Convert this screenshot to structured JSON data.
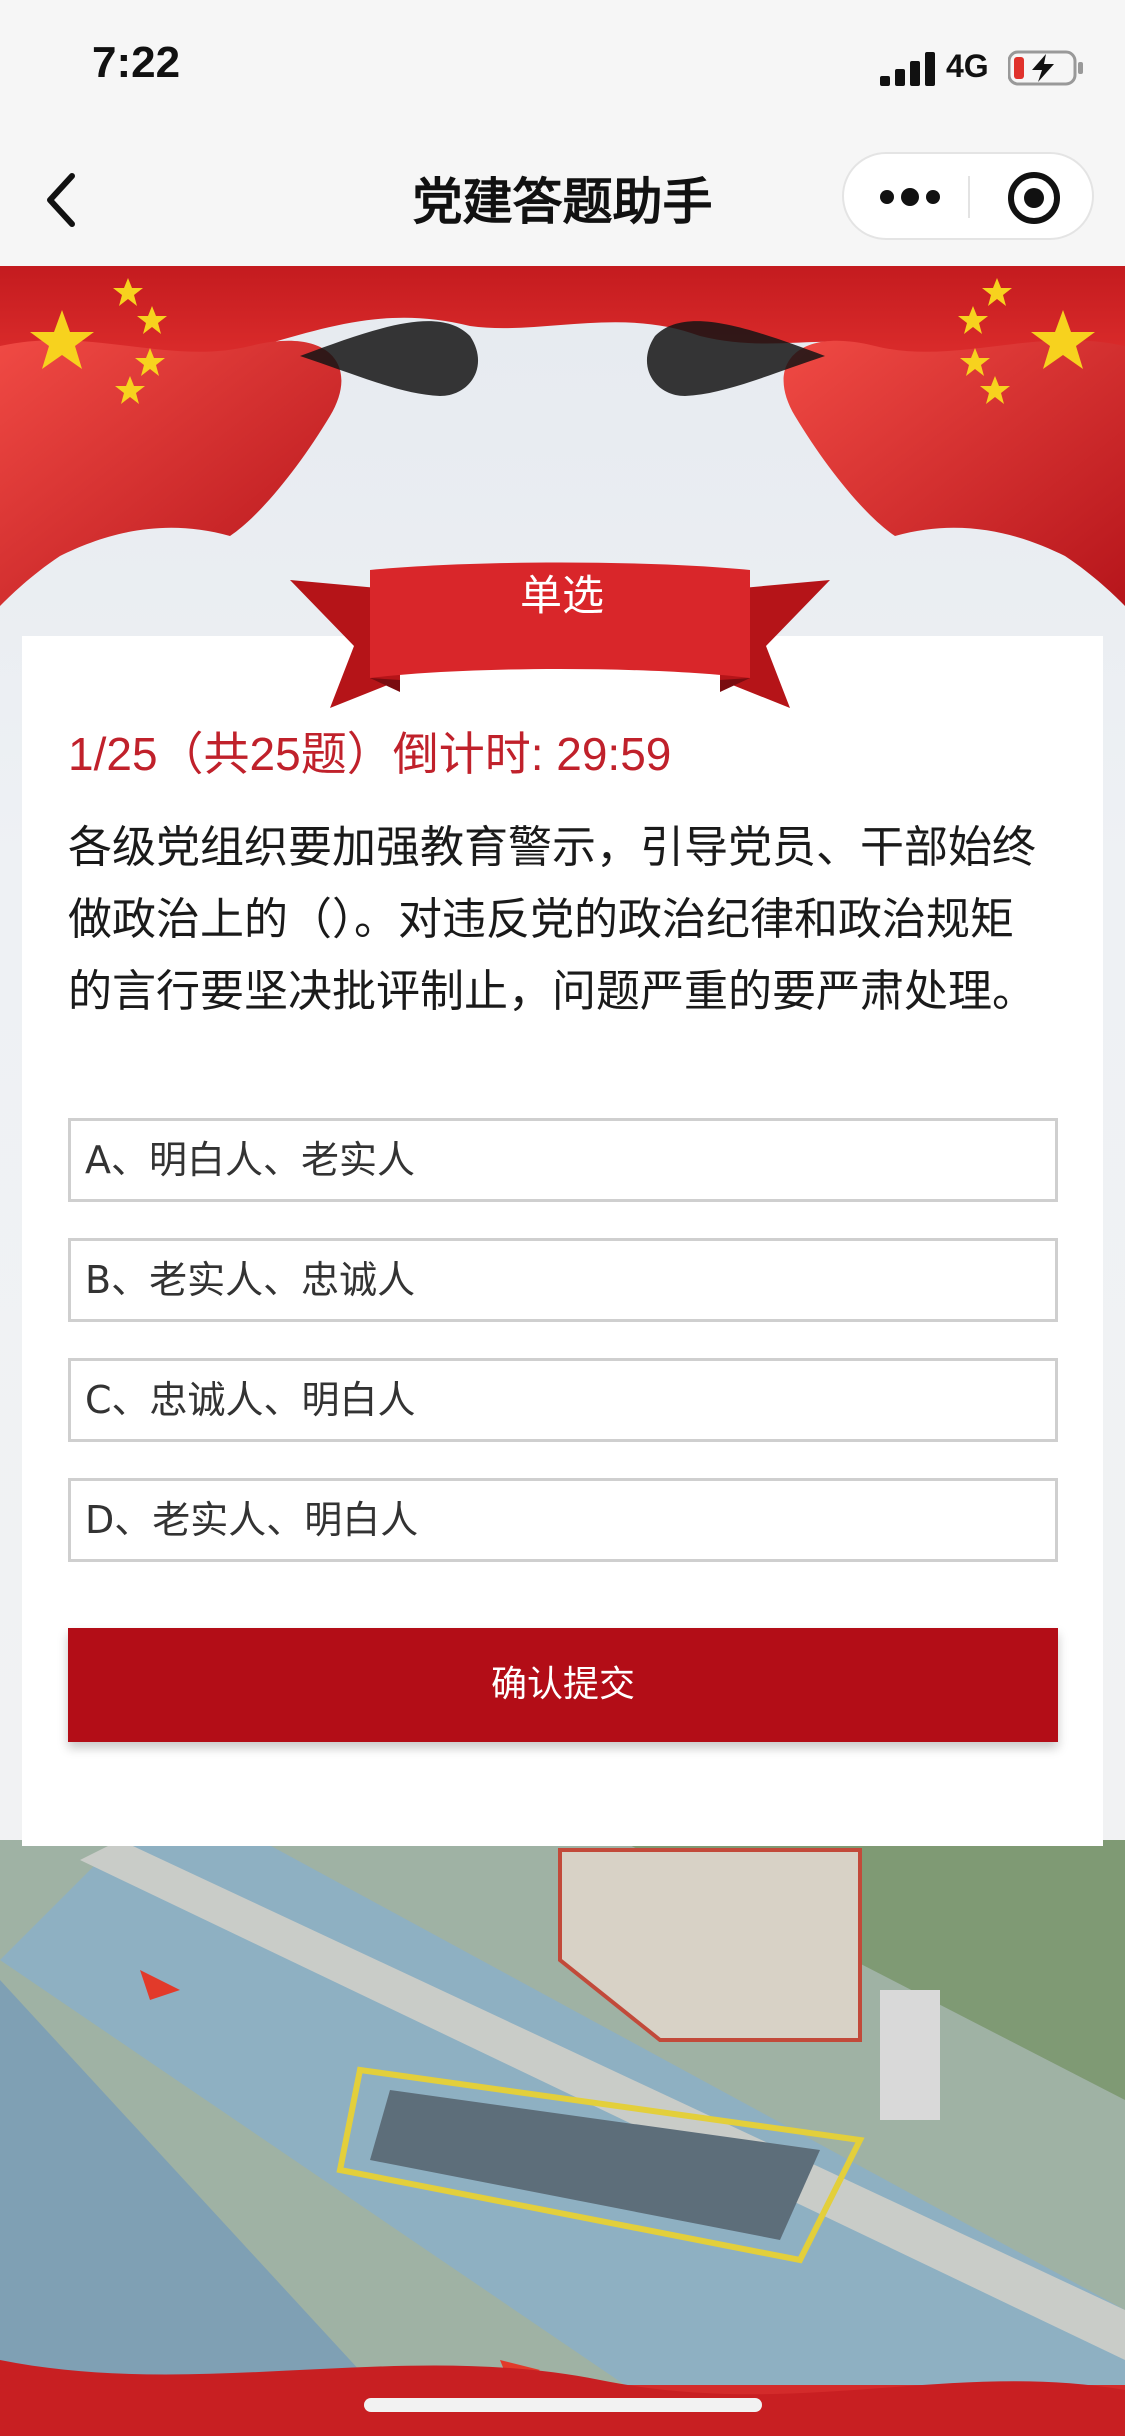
{
  "status_bar": {
    "time": "7:22",
    "network": "4G",
    "icons": [
      "signal-icon",
      "battery-charging-icon"
    ]
  },
  "nav": {
    "title": "党建答题助手",
    "icons": [
      "back-icon",
      "more-icon",
      "target-icon"
    ]
  },
  "quiz": {
    "type_label": "单选",
    "progress": "1/25（共25题）倒计时: 29:59",
    "question": "各级党组织要加强教育警示，引导党员、干部始终做政治上的（）。对违反党的政治纪律和政治规矩的言行要坚决批评制止，问题严重的要严肃处理。",
    "options": [
      "A、明白人、老实人",
      "B、老实人、忠诚人",
      "C、忠诚人、明白人",
      "D、老实人、明白人"
    ],
    "submit_label": "确认提交"
  },
  "colors": {
    "accent_red": "#b30d17",
    "progress_red": "#c0212b",
    "star_yellow": "#f7d21e"
  }
}
